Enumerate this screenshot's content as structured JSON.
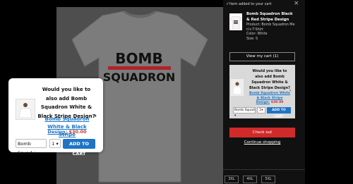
{
  "product": {
    "shirt_line1": "BOMB",
    "shirt_line2": "SQUADRON"
  },
  "popup": {
    "question": "Would you like to also add Bomb Squadron White & Black Stripe Design?",
    "product_link": "Bomb Squadron White & Black Stripe",
    "price_label": "Design:",
    "price_value": "$30.00",
    "variant_value": "Bomb Squad",
    "qty_value": "1",
    "add_button": "ADD TO CART"
  },
  "drawer": {
    "added_text": "Item added to your cart",
    "item": {
      "title": "Bomb Squadron Black & Red Stripe Design",
      "product": "Product: Bomb Squadron Me n's T-Shirt",
      "color": "Color: White",
      "size": "Size: S"
    },
    "view_cart": "View my cart (1)",
    "upsell": {
      "question": "Would you like to also add Bomb Squadron White & Black Stripe Design?",
      "link": "Bomb Squadron White & Black Stripe",
      "price_label": "Design:",
      "price_value": "$30.00",
      "variant_value": "Bomb Squad",
      "qty_value": "1",
      "add_button": "ADD TO CART"
    },
    "checkout": "Check out",
    "continue": "Continue shopping"
  },
  "sizes": [
    "3XL",
    "4XL",
    "5XL"
  ],
  "colors": {
    "accent_blue": "#1f73c4",
    "checkout_red": "#d02a2a",
    "price_red": "#c0392b"
  }
}
